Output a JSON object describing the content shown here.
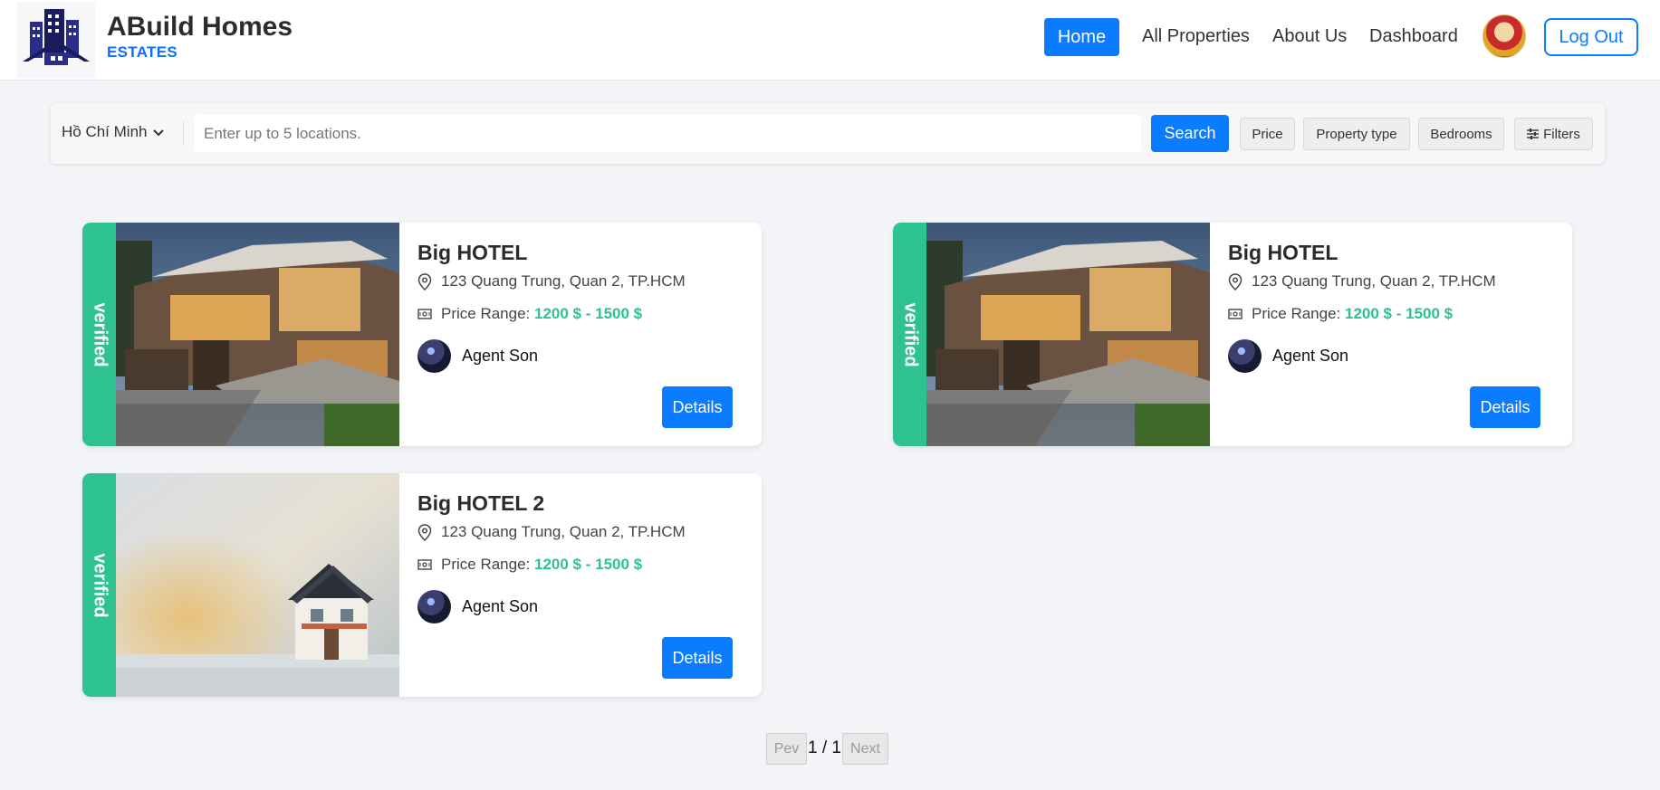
{
  "header": {
    "brand_title": "ABuild Homes",
    "brand_subtitle": "ESTATES",
    "nav": [
      {
        "label": "Home",
        "active": true
      },
      {
        "label": "All Properties"
      },
      {
        "label": "About Us"
      },
      {
        "label": "Dashboard"
      }
    ],
    "logout_label": "Log Out"
  },
  "search": {
    "city": "Hồ Chí Minh",
    "placeholder": "Enter up to 5 locations.",
    "button_label": "Search",
    "filters": [
      "Price",
      "Property type",
      "Bedrooms",
      "Filters"
    ]
  },
  "listings": [
    {
      "badge": "verified",
      "title": "Big HOTEL",
      "address": "123 Quang Trung, Quan 2, TP.HCM",
      "price_label": "Price Range:",
      "price_value": "1200 $ - 1500 $",
      "agent": "Agent Son",
      "details_label": "Details",
      "image": "modern-house-photo"
    },
    {
      "badge": "verified",
      "title": "Big HOTEL",
      "address": "123 Quang Trung, Quan 2, TP.HCM",
      "price_label": "Price Range:",
      "price_value": "1200 $ - 1500 $",
      "agent": "Agent Son",
      "details_label": "Details",
      "image": "modern-house-photo"
    },
    {
      "badge": "verified",
      "title": "Big HOTEL 2",
      "address": "123 Quang Trung, Quan 2, TP.HCM",
      "price_label": "Price Range:",
      "price_value": "1200 $ - 1500 $",
      "agent": "Agent Son",
      "details_label": "Details",
      "image": "small-house-photo"
    }
  ],
  "pagination": {
    "prev_label": "Pev",
    "page_text": "1 / 1",
    "next_label": "Next"
  },
  "colors": {
    "primary": "#0b7bff",
    "verified": "#2ec290",
    "background": "#f3f4f8"
  }
}
